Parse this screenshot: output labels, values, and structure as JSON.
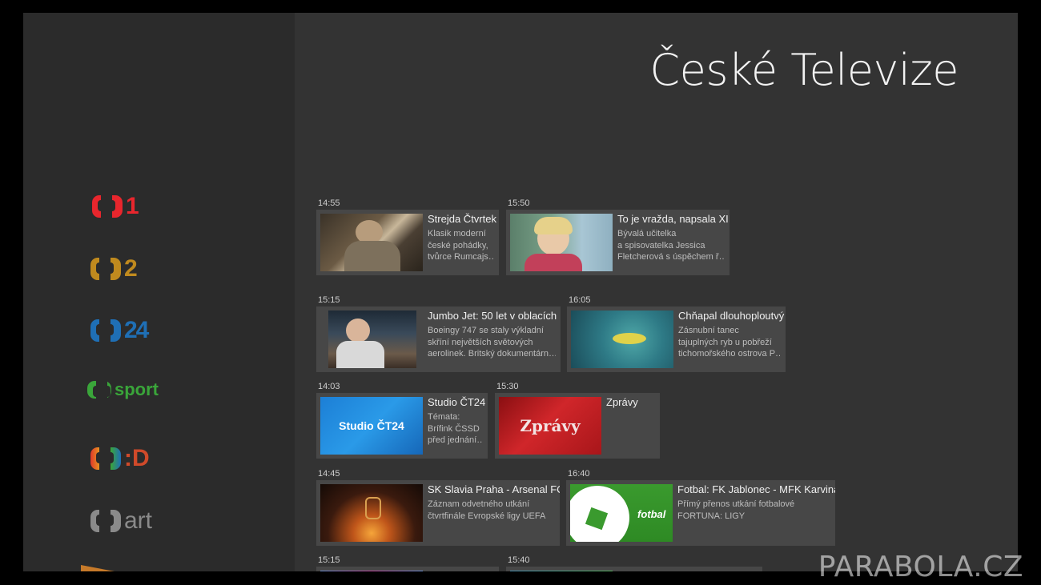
{
  "header": {
    "title": "České Televize"
  },
  "channels": [
    {
      "name": "ct1",
      "label": "1",
      "color": "#e8262d"
    },
    {
      "name": "ct2",
      "label": "2",
      "color": "#c08a1e"
    },
    {
      "name": "ct24",
      "label": "24",
      "color": "#1f6fb5"
    },
    {
      "name": "ctsport",
      "label": "sport",
      "color": "#3aa53a"
    },
    {
      "name": "ctd",
      "label": ":D",
      "color": "#d04a2a"
    },
    {
      "name": "ctart",
      "label": "art",
      "color": "#8a8a8a"
    }
  ],
  "rows": [
    {
      "items": [
        {
          "time": "14:55",
          "title": "Strejda Čtvrtek",
          "desc": [
            "Klasik moderní",
            "české pohádky,",
            "tvůrce Rumcajs…"
          ]
        },
        {
          "time": "15:50",
          "title": "To je vražda, napsala XII",
          "desc": [
            "Bývalá učitelka",
            "a spisovatelka Jessica",
            "Fletcherová s úspěchem ř…"
          ]
        }
      ]
    },
    {
      "items": [
        {
          "time": "15:15",
          "title": "Jumbo Jet: 50 let v oblacích",
          "desc": [
            "Boeingy 747 se staly výkladní",
            "skříní největších světových",
            "aerolinek. Britský dokumentárn…"
          ]
        },
        {
          "time": "16:05",
          "title": "Chňapal dlouhoploutvý",
          "desc": [
            "Zásnubní tanec",
            "tajuplných ryb u pobřeží",
            "tichomořského ostrova P…"
          ]
        }
      ]
    },
    {
      "items": [
        {
          "time": "14:03",
          "title": "Studio ČT24",
          "desc": [
            "Témata:",
            "Brífink ČSSD",
            "před jednání…"
          ],
          "thumb_text": "Studio ČT24"
        },
        {
          "time": "15:30",
          "title": "Zprávy",
          "desc": [],
          "thumb_text": "Zprávy"
        }
      ]
    },
    {
      "items": [
        {
          "time": "14:45",
          "title": "SK Slavia Praha - Arsenal FC",
          "desc": [
            "Záznam odvetného utkání",
            "čtvrtfinále Evropské ligy UEFA"
          ]
        },
        {
          "time": "16:40",
          "title": "Fotbal: FK Jablonec - MFK Karviná",
          "desc": [
            "Přímý přenos utkání fotbalové",
            "FORTUNA: LIGY"
          ],
          "thumb_text": "fotbal"
        }
      ]
    },
    {
      "items": [
        {
          "time": "15:15"
        },
        {
          "time": "15:40"
        }
      ]
    }
  ],
  "watermark": "PARABOLA.CZ"
}
